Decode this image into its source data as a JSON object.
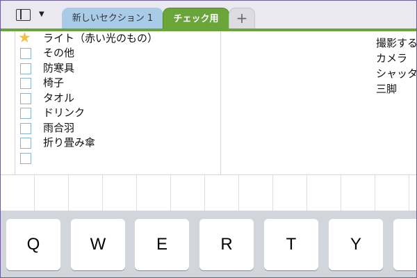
{
  "tabs": [
    {
      "label": "新しいセクション 1",
      "active": false,
      "color": "#a9cbe8"
    },
    {
      "label": "チェック用",
      "active": true,
      "color": "#6aa53a"
    }
  ],
  "add_tab_label": "+",
  "dropdown_glyph": "▼",
  "checklist": [
    {
      "label": "ライト（赤い光のもの）",
      "marker": "star-icon"
    },
    {
      "label": "その他",
      "marker": "checkbox"
    },
    {
      "label": "防寒具",
      "marker": "checkbox"
    },
    {
      "label": "椅子",
      "marker": "checkbox"
    },
    {
      "label": "タオル",
      "marker": "checkbox"
    },
    {
      "label": "ドリンク",
      "marker": "checkbox"
    },
    {
      "label": "雨合羽",
      "marker": "checkbox"
    },
    {
      "label": "折り畳み傘",
      "marker": "checkbox"
    },
    {
      "label": "",
      "marker": "checkbox"
    }
  ],
  "right_list": [
    "撮影する",
    "カメラ",
    "シャッタ",
    "三脚"
  ],
  "keyboard_keys": [
    "Q",
    "W",
    "E",
    "R",
    "T",
    "Y",
    ""
  ],
  "accent_color": "#6aa53a",
  "star_color": "#f0c14b"
}
